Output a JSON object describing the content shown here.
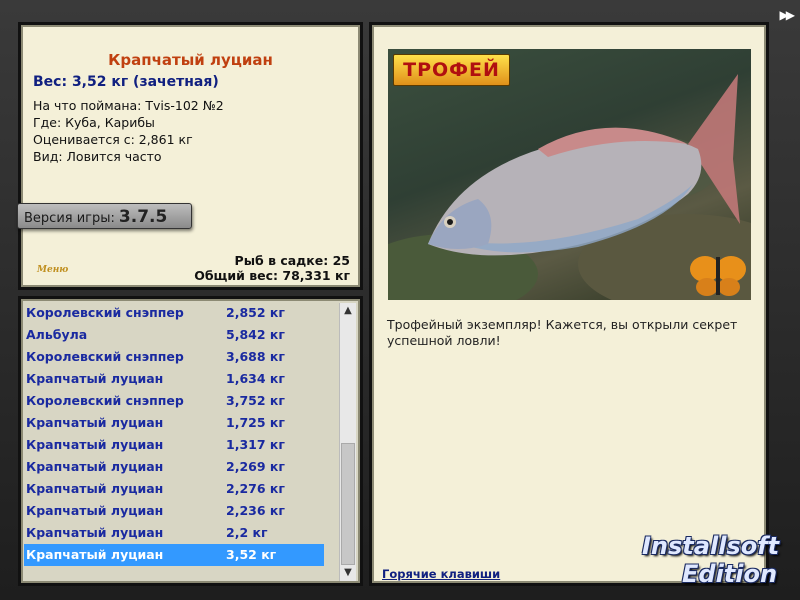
{
  "info": {
    "title": "Крапчатый луциан",
    "weight": "Вес: 3,52 кг (зачетная)",
    "lines": [
      "На что поймана: Tvis-102 №2",
      "Где: Куба, Карибы",
      "Оценивается с: 2,861 кг",
      "Вид: Ловится часто"
    ],
    "version_label": "Версия игры:",
    "version_number": "3.7.5",
    "menu_label": "Меню",
    "stats": {
      "cage": "Рыб в садке: 25",
      "total": "Общий вес: 78,331 кг"
    }
  },
  "catch_list": [
    {
      "name": "Королевский снэппер",
      "weight": "2,852 кг"
    },
    {
      "name": "Альбула",
      "weight": "5,842 кг"
    },
    {
      "name": "Королевский снэппер",
      "weight": "3,688 кг"
    },
    {
      "name": "Крапчатый луциан",
      "weight": "1,634 кг"
    },
    {
      "name": "Королевский снэппер",
      "weight": "3,752 кг"
    },
    {
      "name": "Крапчатый луциан",
      "weight": "1,725 кг"
    },
    {
      "name": "Крапчатый луциан",
      "weight": "1,317 кг"
    },
    {
      "name": "Крапчатый луциан",
      "weight": "2,269 кг"
    },
    {
      "name": "Крапчатый луциан",
      "weight": "2,276 кг"
    },
    {
      "name": "Крапчатый луциан",
      "weight": "2,236 кг"
    },
    {
      "name": "Крапчатый луциан",
      "weight": "2,2 кг"
    },
    {
      "name": "Крапчатый луциан",
      "weight": "3,52 кг",
      "selected": true
    }
  ],
  "detail": {
    "trophy_badge": "ТРОФЕЙ",
    "caption": "Трофейный экземпляр! Кажется, вы открыли секрет успешной ловли!",
    "hotkeys_link": "Горячие клавиши"
  },
  "watermark": {
    "line1": "Installsoft",
    "line2": "Edition"
  },
  "colors": {
    "title": "#c04010",
    "list_text": "#1a2aa0",
    "selection": "#3399ff",
    "panel_bg": "#f4f0d8"
  }
}
